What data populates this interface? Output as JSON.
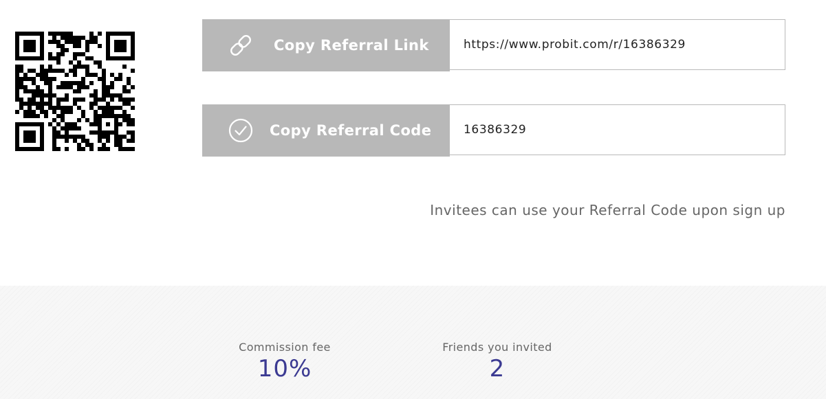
{
  "referral": {
    "link": {
      "button_label": "Copy Referral Link",
      "icon": "link-icon",
      "value": "https://www.probit.com/r/16386329"
    },
    "code": {
      "button_label": "Copy Referral Code",
      "icon": "check-circle-icon",
      "value": "16386329"
    },
    "hint": "Invitees can use your Referral Code upon sign up",
    "qr_icon": "qr-code"
  },
  "stats": {
    "commission": {
      "label": "Commission fee",
      "value": "10%"
    },
    "friends": {
      "label": "Friends you invited",
      "value": "2"
    }
  },
  "colors": {
    "button_bg": "#b8b8b8",
    "accent_value": "#3b3a92",
    "border": "#b9b9b9"
  }
}
